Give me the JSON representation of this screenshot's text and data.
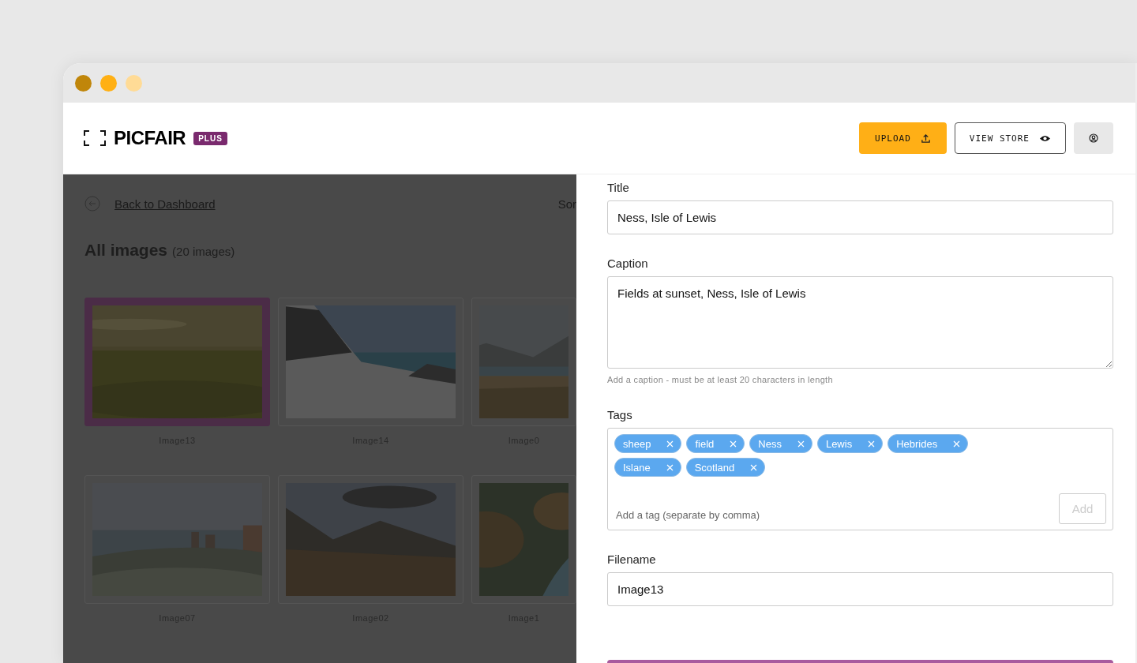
{
  "brand": {
    "name": "PICFAIR",
    "badge": "PLUS"
  },
  "header_buttons": [
    {
      "kind": "primary",
      "label": "UPLOAD"
    },
    {
      "kind": "outline",
      "label": "VIEW STORE"
    },
    {
      "kind": "account"
    }
  ],
  "back_link": "Back to Dashboard",
  "sort_label": "Sor",
  "gallery": {
    "title": "All images",
    "count": "(20 images)",
    "items": [
      {
        "name": "Image13",
        "selected": true
      },
      {
        "name": "Image14",
        "selected": false
      },
      {
        "name": "Image0",
        "selected": false
      },
      {
        "name": "Image07",
        "selected": false
      },
      {
        "name": "Image02",
        "selected": false
      },
      {
        "name": "Image1",
        "selected": false
      }
    ]
  },
  "form": {
    "title": {
      "label": "Title",
      "value": "Ness, Isle of Lewis"
    },
    "caption": {
      "label": "Caption",
      "value": "Fields at sunset, Ness, Isle of Lewis",
      "hint": "Add a caption - must be at least 20 characters in length"
    },
    "tags": {
      "label": "Tags",
      "items": [
        "sheep",
        "field",
        "Ness",
        "Lewis",
        "Hebrides",
        "Islane",
        "Scotland"
      ],
      "placeholder": "Add a tag (separate by comma)",
      "add_button": "Add"
    },
    "filename": {
      "label": "Filename",
      "value": "Image13"
    }
  }
}
